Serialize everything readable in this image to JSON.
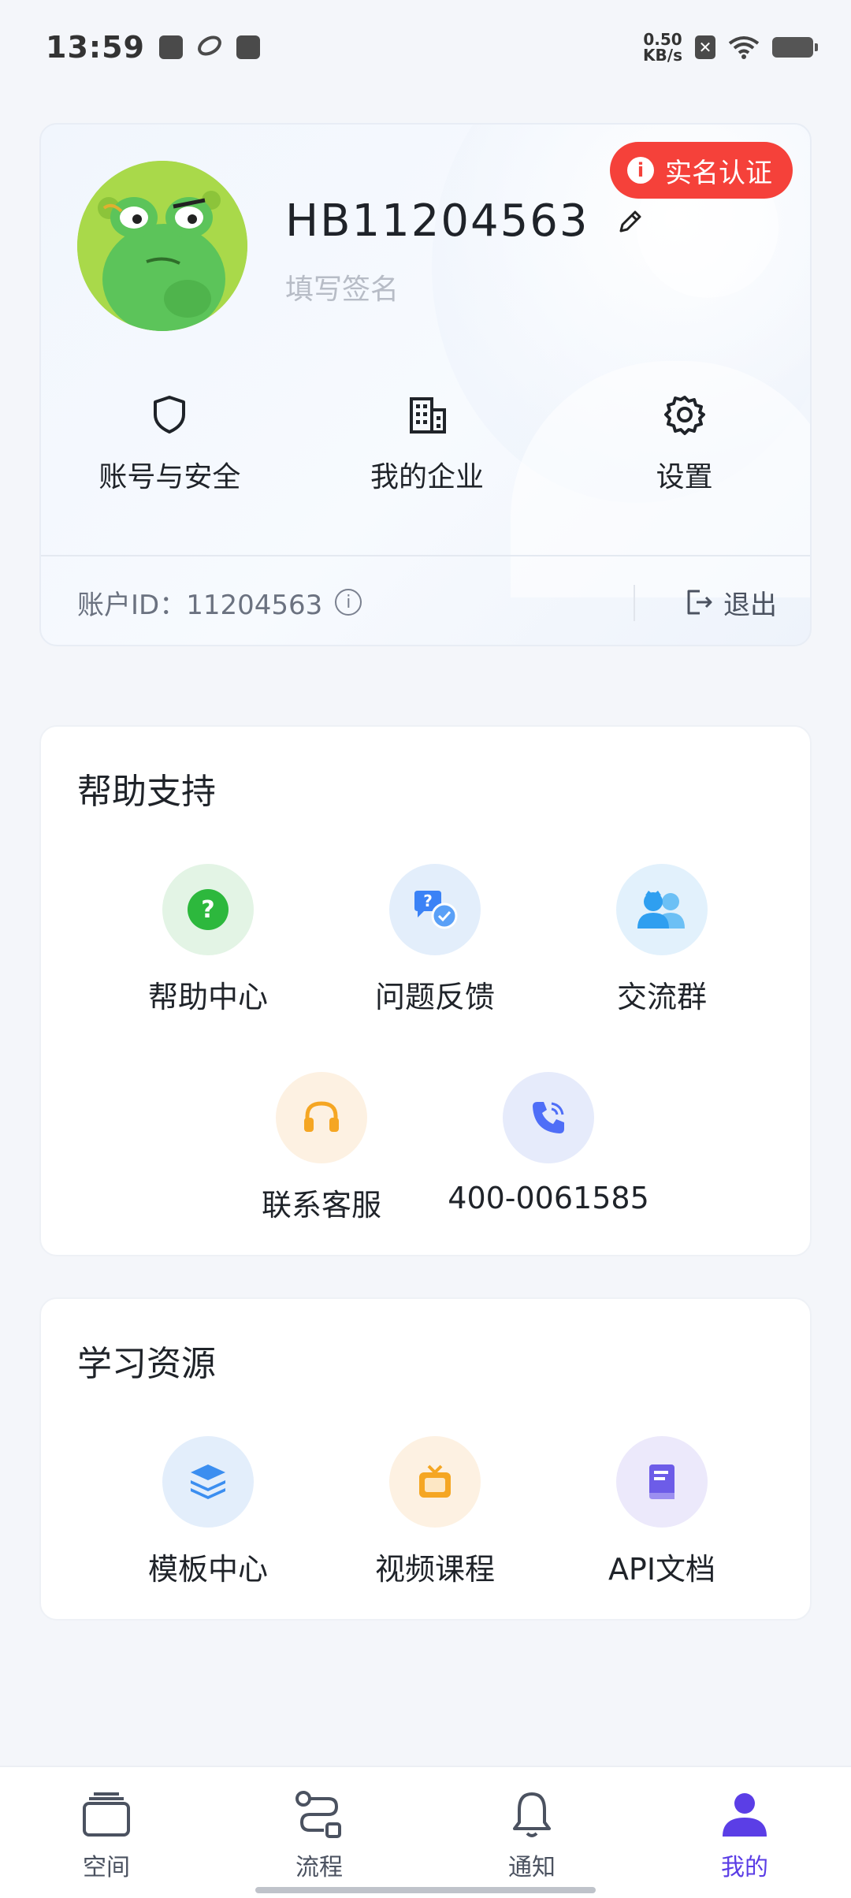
{
  "status_bar": {
    "time": "13:59",
    "net_speed_value": "0.50",
    "net_speed_unit": "KB/s",
    "icons": [
      "notification-icon",
      "app-icon",
      "mail-icon",
      "no-sim-icon",
      "wifi-icon",
      "battery-icon"
    ]
  },
  "profile": {
    "username": "HB11204563",
    "signature_placeholder": "填写签名",
    "verify_badge": "实名认证",
    "quick_actions": [
      {
        "label": "账号与安全",
        "icon": "shield-icon"
      },
      {
        "label": "我的企业",
        "icon": "building-icon"
      },
      {
        "label": "设置",
        "icon": "gear-icon"
      }
    ],
    "account_id": "账户ID：11204563",
    "logout_label": "退出"
  },
  "help_support": {
    "title": "帮助支持",
    "items": [
      {
        "label": "帮助中心",
        "icon": "question-icon",
        "color": "#2db83d"
      },
      {
        "label": "问题反馈",
        "icon": "feedback-chat-icon",
        "color": "#3b82f6"
      },
      {
        "label": "交流群",
        "icon": "group-icon",
        "color": "#38a3f1"
      },
      {
        "label": "联系客服",
        "icon": "headset-icon",
        "color": "#f5a623"
      },
      {
        "label": "400-0061585",
        "icon": "phone-icon",
        "color": "#4f6ef7"
      }
    ]
  },
  "learning": {
    "title": "学习资源",
    "items": [
      {
        "label": "模板中心",
        "icon": "layers-icon",
        "color": "#3b8ef0"
      },
      {
        "label": "视频课程",
        "icon": "tv-icon",
        "color": "#f5a623"
      },
      {
        "label": "API文档",
        "icon": "book-icon",
        "color": "#6d5ce8"
      }
    ]
  },
  "bottom_nav": {
    "items": [
      {
        "label": "空间",
        "icon": "space-icon"
      },
      {
        "label": "流程",
        "icon": "flow-icon"
      },
      {
        "label": "通知",
        "icon": "bell-icon"
      },
      {
        "label": "我的",
        "icon": "user-icon"
      }
    ],
    "active": "我的",
    "active_color": "#5b3ee6"
  }
}
